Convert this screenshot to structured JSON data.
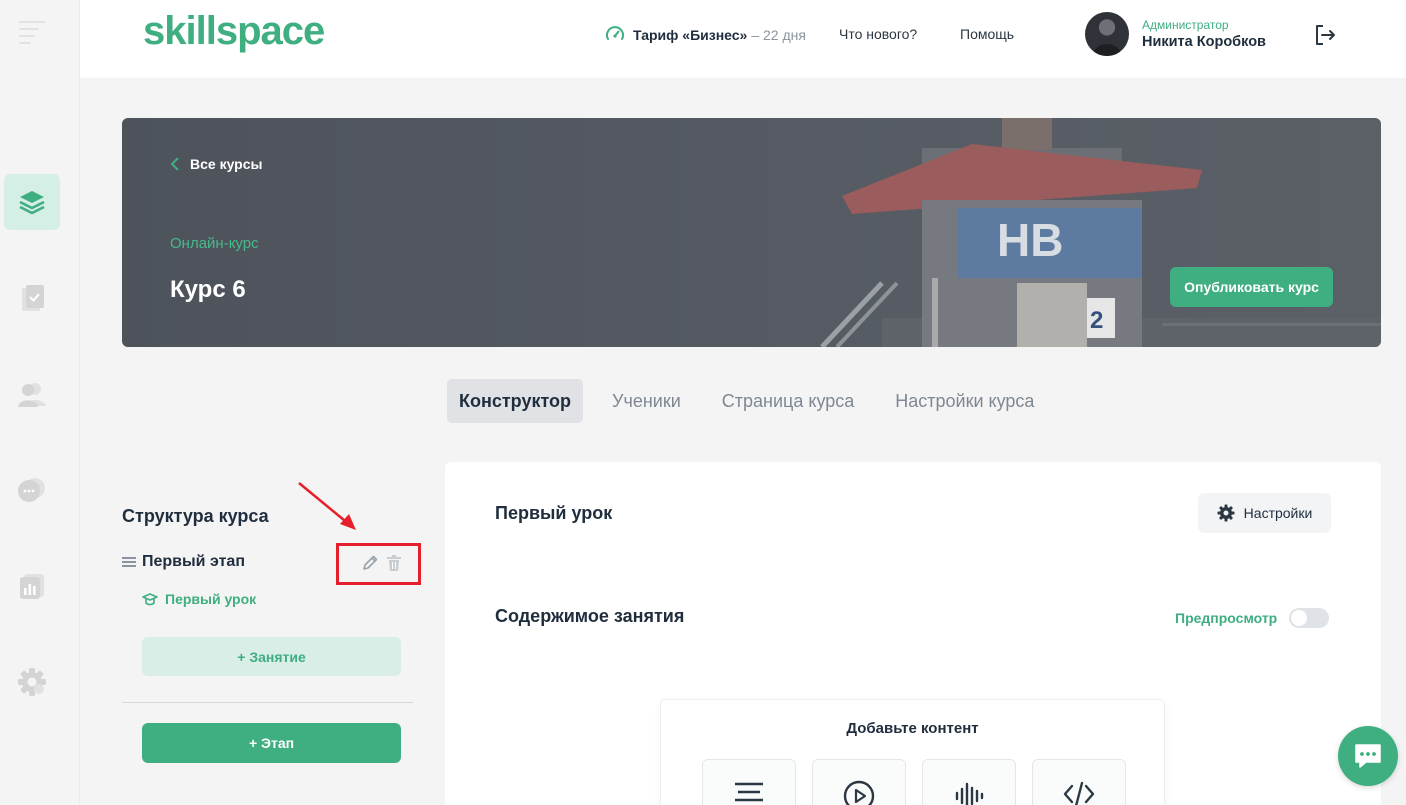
{
  "topbar": {
    "logo": "skillspace",
    "tariff_label": "Тариф «Бизнес»",
    "tariff_days": "– 22 дня",
    "whats_new": "Что нового?",
    "help": "Помощь",
    "user_role": "Администратор",
    "user_name": "Никита Коробков"
  },
  "sidebar": {
    "items": [
      {
        "icon": "layers-icon",
        "active": true
      },
      {
        "icon": "document-check-icon",
        "active": false
      },
      {
        "icon": "users-icon",
        "active": false
      },
      {
        "icon": "chat-icon",
        "active": false
      },
      {
        "icon": "analytics-icon",
        "active": false
      },
      {
        "icon": "gear-icon",
        "active": false
      }
    ]
  },
  "hero": {
    "back_label": "Все курсы",
    "course_type": "Онлайн-курс",
    "course_title": "Курс 6",
    "publish_label": "Опубликовать курс"
  },
  "tabs": [
    {
      "label": "Конструктор",
      "active": true
    },
    {
      "label": "Ученики",
      "active": false
    },
    {
      "label": "Страница курса",
      "active": false
    },
    {
      "label": "Настройки курса",
      "active": false
    }
  ],
  "structure": {
    "title": "Структура курса",
    "stage_name": "Первый этап",
    "lesson_name": "Первый урок",
    "add_lesson_label": "+ Занятие",
    "add_stage_label": "+ Этап"
  },
  "editor": {
    "lesson_title": "Первый урок",
    "settings_label": "Настройки",
    "content_title": "Содержимое занятия",
    "preview_label": "Предпросмотр",
    "preview_enabled": false,
    "add_content_title": "Добавьте контент",
    "content_types": [
      "text-icon",
      "video-icon",
      "audio-icon",
      "code-icon"
    ]
  },
  "colors": {
    "accent": "#3fae80",
    "accent_light": "#d9eee7",
    "highlight": "#e5202c"
  }
}
